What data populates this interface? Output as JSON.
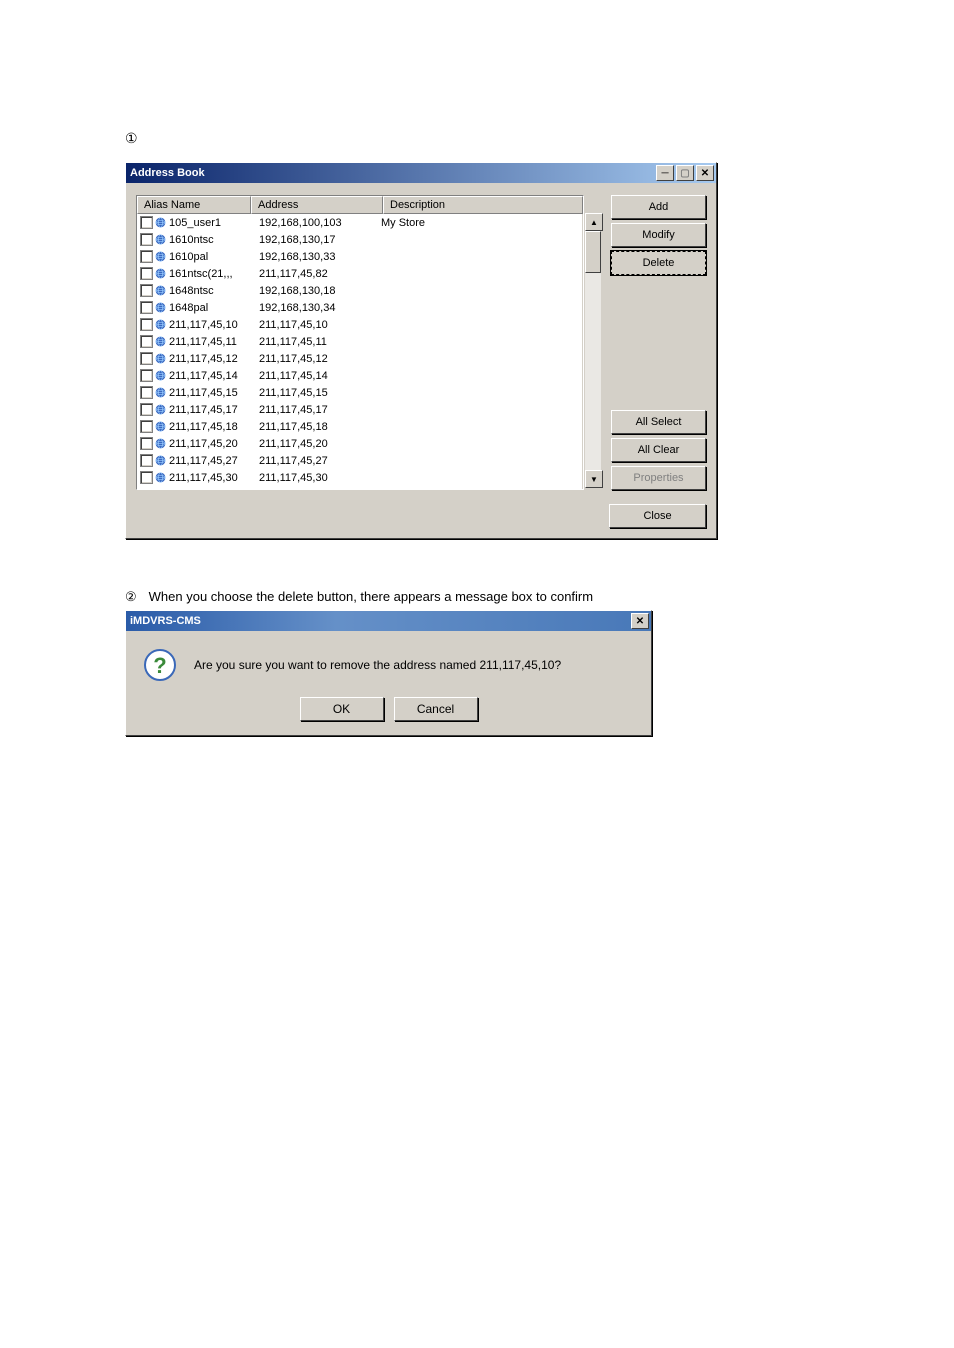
{
  "step1_marker": "①",
  "address_book": {
    "title": "Address Book",
    "columns": {
      "alias": "Alias Name",
      "address": "Address",
      "description": "Description"
    },
    "rows": [
      {
        "alias": "105_user1",
        "address": "192,168,100,103",
        "description": "My Store"
      },
      {
        "alias": "1610ntsc",
        "address": "192,168,130,17",
        "description": ""
      },
      {
        "alias": "1610pal",
        "address": "192,168,130,33",
        "description": ""
      },
      {
        "alias": "161ntsc(21,,,",
        "address": "211,117,45,82",
        "description": ""
      },
      {
        "alias": "1648ntsc",
        "address": "192,168,130,18",
        "description": ""
      },
      {
        "alias": "1648pal",
        "address": "192,168,130,34",
        "description": ""
      },
      {
        "alias": "211,117,45,10",
        "address": "211,117,45,10",
        "description": ""
      },
      {
        "alias": "211,117,45,11",
        "address": "211,117,45,11",
        "description": ""
      },
      {
        "alias": "211,117,45,12",
        "address": "211,117,45,12",
        "description": ""
      },
      {
        "alias": "211,117,45,14",
        "address": "211,117,45,14",
        "description": ""
      },
      {
        "alias": "211,117,45,15",
        "address": "211,117,45,15",
        "description": ""
      },
      {
        "alias": "211,117,45,17",
        "address": "211,117,45,17",
        "description": ""
      },
      {
        "alias": "211,117,45,18",
        "address": "211,117,45,18",
        "description": ""
      },
      {
        "alias": "211,117,45,20",
        "address": "211,117,45,20",
        "description": ""
      },
      {
        "alias": "211,117,45,27",
        "address": "211,117,45,27",
        "description": ""
      },
      {
        "alias": "211,117,45,30",
        "address": "211,117,45,30",
        "description": ""
      }
    ],
    "buttons": {
      "add": "Add",
      "modify": "Modify",
      "delete": "Delete",
      "all_select": "All Select",
      "all_clear": "All Clear",
      "properties": "Properties",
      "close": "Close"
    }
  },
  "step2_marker": "②",
  "step2_text": "When you choose the delete button, there appears a message box to confirm",
  "msgbox": {
    "title": "iMDVRS-CMS",
    "message": "Are you sure you want to remove the address named 211,117,45,10?",
    "ok": "OK",
    "cancel": "Cancel"
  }
}
